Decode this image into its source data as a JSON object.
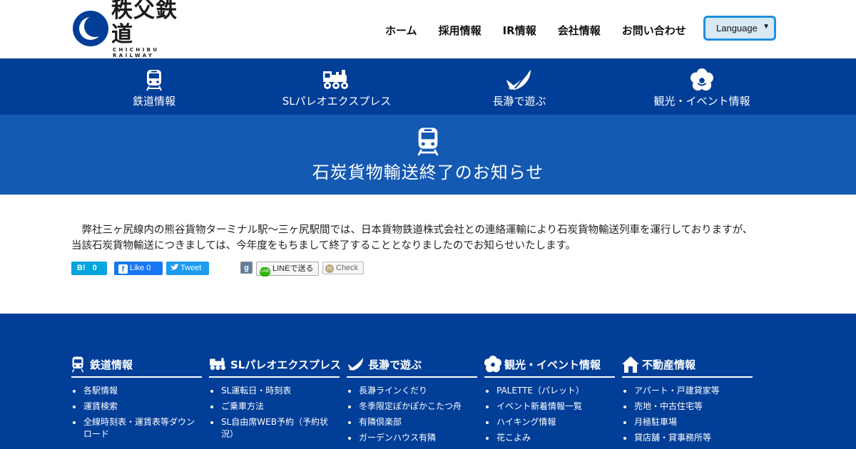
{
  "header": {
    "logo_main": "秩父鉄道",
    "logo_sub": "CHICHIBU RAILWAY",
    "nav": [
      "ホーム",
      "採用情報",
      "IR情報",
      "会社情報",
      "お問い合わせ"
    ],
    "language": "Language"
  },
  "mainnav": {
    "items": [
      "鉄道情報",
      "SLパレオエクスプレス",
      "長瀞で遊ぶ",
      "観光・イベント情報"
    ]
  },
  "page": {
    "title": "石炭貨物輸送終了のお知らせ",
    "body_line1": "　弊社三ヶ尻線内の熊谷貨物ターミナル駅～三ヶ尻駅間では、日本貨物鉄道株式会社との連絡運輸により石炭貨物輸送列車を運行しておりますが、",
    "body_line2": "当該石炭貨物輸送につきましては、今年度をもちまして終了することとなりましたのでお知らせいたします。"
  },
  "share": {
    "hatena_label": "B!",
    "hatena_count": "0",
    "fb_label": "Like",
    "fb_count": "0",
    "tweet_label": "Tweet",
    "google_label": "g",
    "line_label": "LINEで送る",
    "check_label": "Check"
  },
  "footer": {
    "columns": [
      {
        "title": "鉄道情報",
        "items": [
          "各駅情報",
          "運賃検索",
          "全線時刻表・運賃表等ダウンロード"
        ]
      },
      {
        "title": "SLパレオエクスプレス",
        "items": [
          "SL運転日・時刻表",
          "ご乗車方法",
          "SL自由席WEB予約（予約状況）"
        ]
      },
      {
        "title": "長瀞で遊ぶ",
        "items": [
          "長瀞ラインくだり",
          "冬季限定ぽかぽかこたつ舟",
          "有隣倶楽部",
          "ガーデンハウス有隣"
        ]
      },
      {
        "title": "観光・イベント情報",
        "items": [
          "PALETTE（パレット）",
          "イベント新着情報一覧",
          "ハイキング情報",
          "花こよみ"
        ]
      },
      {
        "title": "不動産情報",
        "items": [
          "アパート・戸建貸家等",
          "売地・中古住宅等",
          "月極駐車場",
          "貸店舗・貸事務所等"
        ]
      }
    ]
  },
  "colors": {
    "brand_blue": "#003e98",
    "title_blue": "#1459b2"
  }
}
